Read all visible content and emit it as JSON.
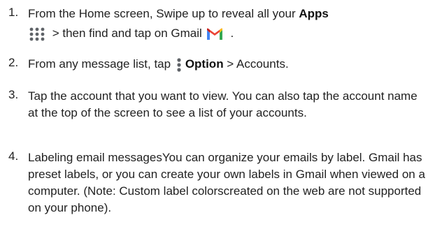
{
  "steps": [
    {
      "number": "1.",
      "line1_text": "From the Home screen, Swipe up to reveal all your ",
      "line1_bold": "Apps",
      "line2_text_a": " > then find and tap on Gmail",
      "line2_text_b": " .",
      "icons": [
        "apps-grid-icon",
        "gmail-icon"
      ]
    },
    {
      "number": "2.",
      "text_a": "From any message list, tap",
      "bold": "Option",
      "text_b": " > Accounts.",
      "icons": [
        "more-options-icon"
      ]
    },
    {
      "number": "3.",
      "text": "Tap the account that you want to view. You can also tap the account name at the top of the screen to see a list of your accounts."
    },
    {
      "number": "4.",
      "text": "Labeling email messagesYou can organize your emails by label. Gmail has preset labels, or you can create your own labels in Gmail when viewed on a computer. (Note: Custom label colorscreated on the web are not supported on your phone)."
    }
  ],
  "colors": {
    "text": "#222222",
    "icon_grey": "#5f6368",
    "gmail_red": "#EA4335",
    "gmail_blue": "#4285F4",
    "gmail_green": "#34A853",
    "gmail_yellow": "#FBBC04"
  }
}
